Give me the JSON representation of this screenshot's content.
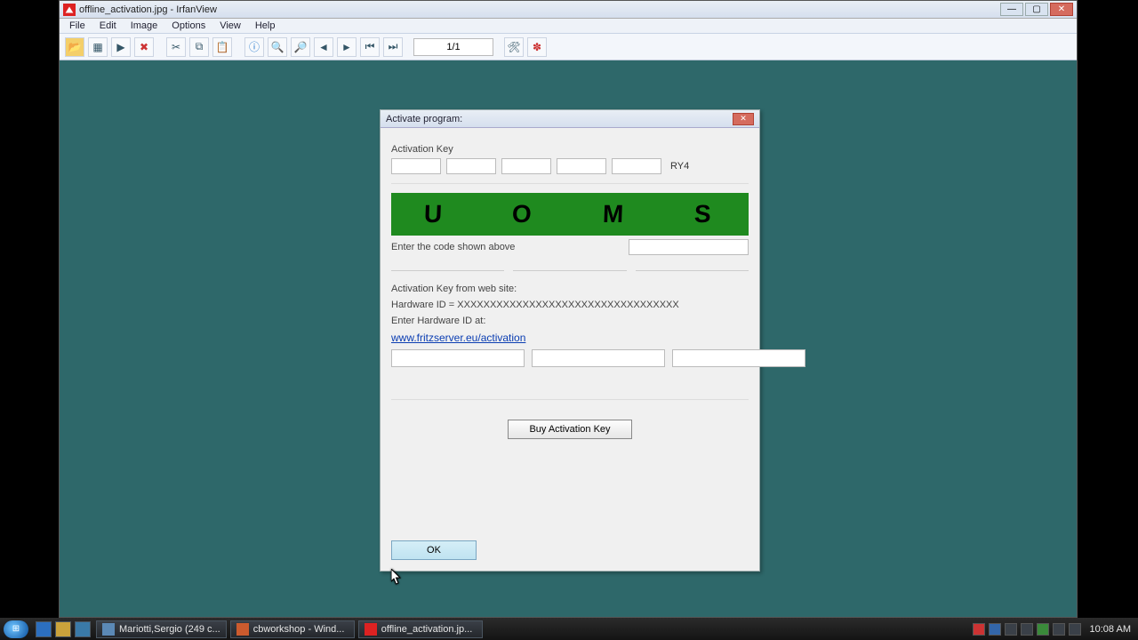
{
  "irfanview": {
    "title": "offline_activation.jpg - IrfanView",
    "menus": [
      "File",
      "Edit",
      "Image",
      "Options",
      "View",
      "Help"
    ],
    "page_counter": "1/1",
    "toolbar_icons": [
      "open",
      "thumbnails",
      "slideshow",
      "delete",
      "cut",
      "copy",
      "paste",
      "info",
      "zoom-in",
      "zoom-out",
      "prev",
      "next",
      "first",
      "last",
      "settings",
      "about"
    ]
  },
  "dialog": {
    "title": "Activate program:",
    "activation_key_label": "Activation Key",
    "activation_key_fields": [
      "",
      "",
      "",
      "",
      ""
    ],
    "activation_key_last": "RY4",
    "captcha_letters": [
      "U",
      "O",
      "M",
      "S"
    ],
    "enter_code_label": "Enter the code shown above",
    "code_input": "",
    "from_web_label": "Activation Key from web site:",
    "hardware_id_label": "Hardware ID = XXXXXXXXXXXXXXXXXXXXXXXXXXXXXXXXXX",
    "enter_hw_at_label": "Enter Hardware ID at:",
    "activation_url": "www.fritzserver.eu/activation",
    "hw_fields": [
      "",
      "",
      ""
    ],
    "buy_button": "Buy Activation Key",
    "ok_button": "OK"
  },
  "taskbar": {
    "buttons": [
      {
        "label": "Mariotti,Sergio (249 c..."
      },
      {
        "label": "cbworkshop - Wind..."
      },
      {
        "label": "offline_activation.jp..."
      }
    ],
    "clock": "10:08 AM"
  }
}
